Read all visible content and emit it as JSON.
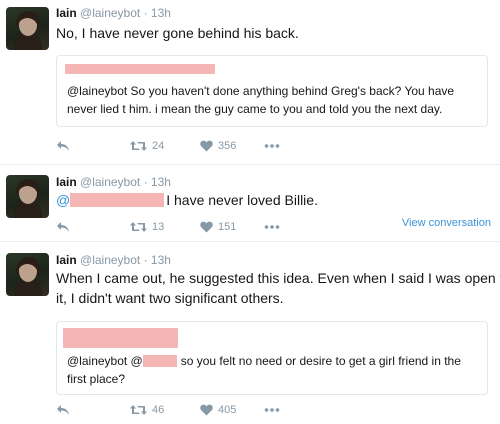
{
  "tweets": [
    {
      "name": "Iain",
      "handle": "@laineybot",
      "dot": "·",
      "time": "13h",
      "text": "No, I have never gone behind his back.",
      "quote": {
        "text": "@laineybot So you haven't done anything behind Greg's back? You have never lied t him. i mean the guy came to you and told you the next day."
      },
      "retweets": "24",
      "likes": "356"
    },
    {
      "name": "Iain",
      "handle": "@laineybot",
      "dot": "·",
      "time": "13h",
      "mention_prefix": "@",
      "text": "I have never loved Billie.",
      "retweets": "13",
      "likes": "151",
      "view_conversation": "View conversation"
    },
    {
      "name": "Iain",
      "handle": "@laineybot",
      "dot": "·",
      "time": "13h",
      "text_line1": "When I came out, he suggested this idea. Even when I said I was open to",
      "text_line2": "it, I didn't want two significant others.",
      "quote": {
        "prefix": "@laineybot @",
        "line1": "so you felt no need or desire to get a girl friend in the",
        "line2": "first place?"
      },
      "retweets": "46",
      "likes": "405"
    }
  ],
  "icons": {
    "reply": "reply-icon",
    "retweet": "retweet-icon",
    "like": "heart-icon",
    "more": "more-icon"
  },
  "colors": {
    "muted": "#8899a6",
    "link": "#3b94d9",
    "redaction": "#f4b5b5",
    "divider": "#e6ecf0"
  }
}
